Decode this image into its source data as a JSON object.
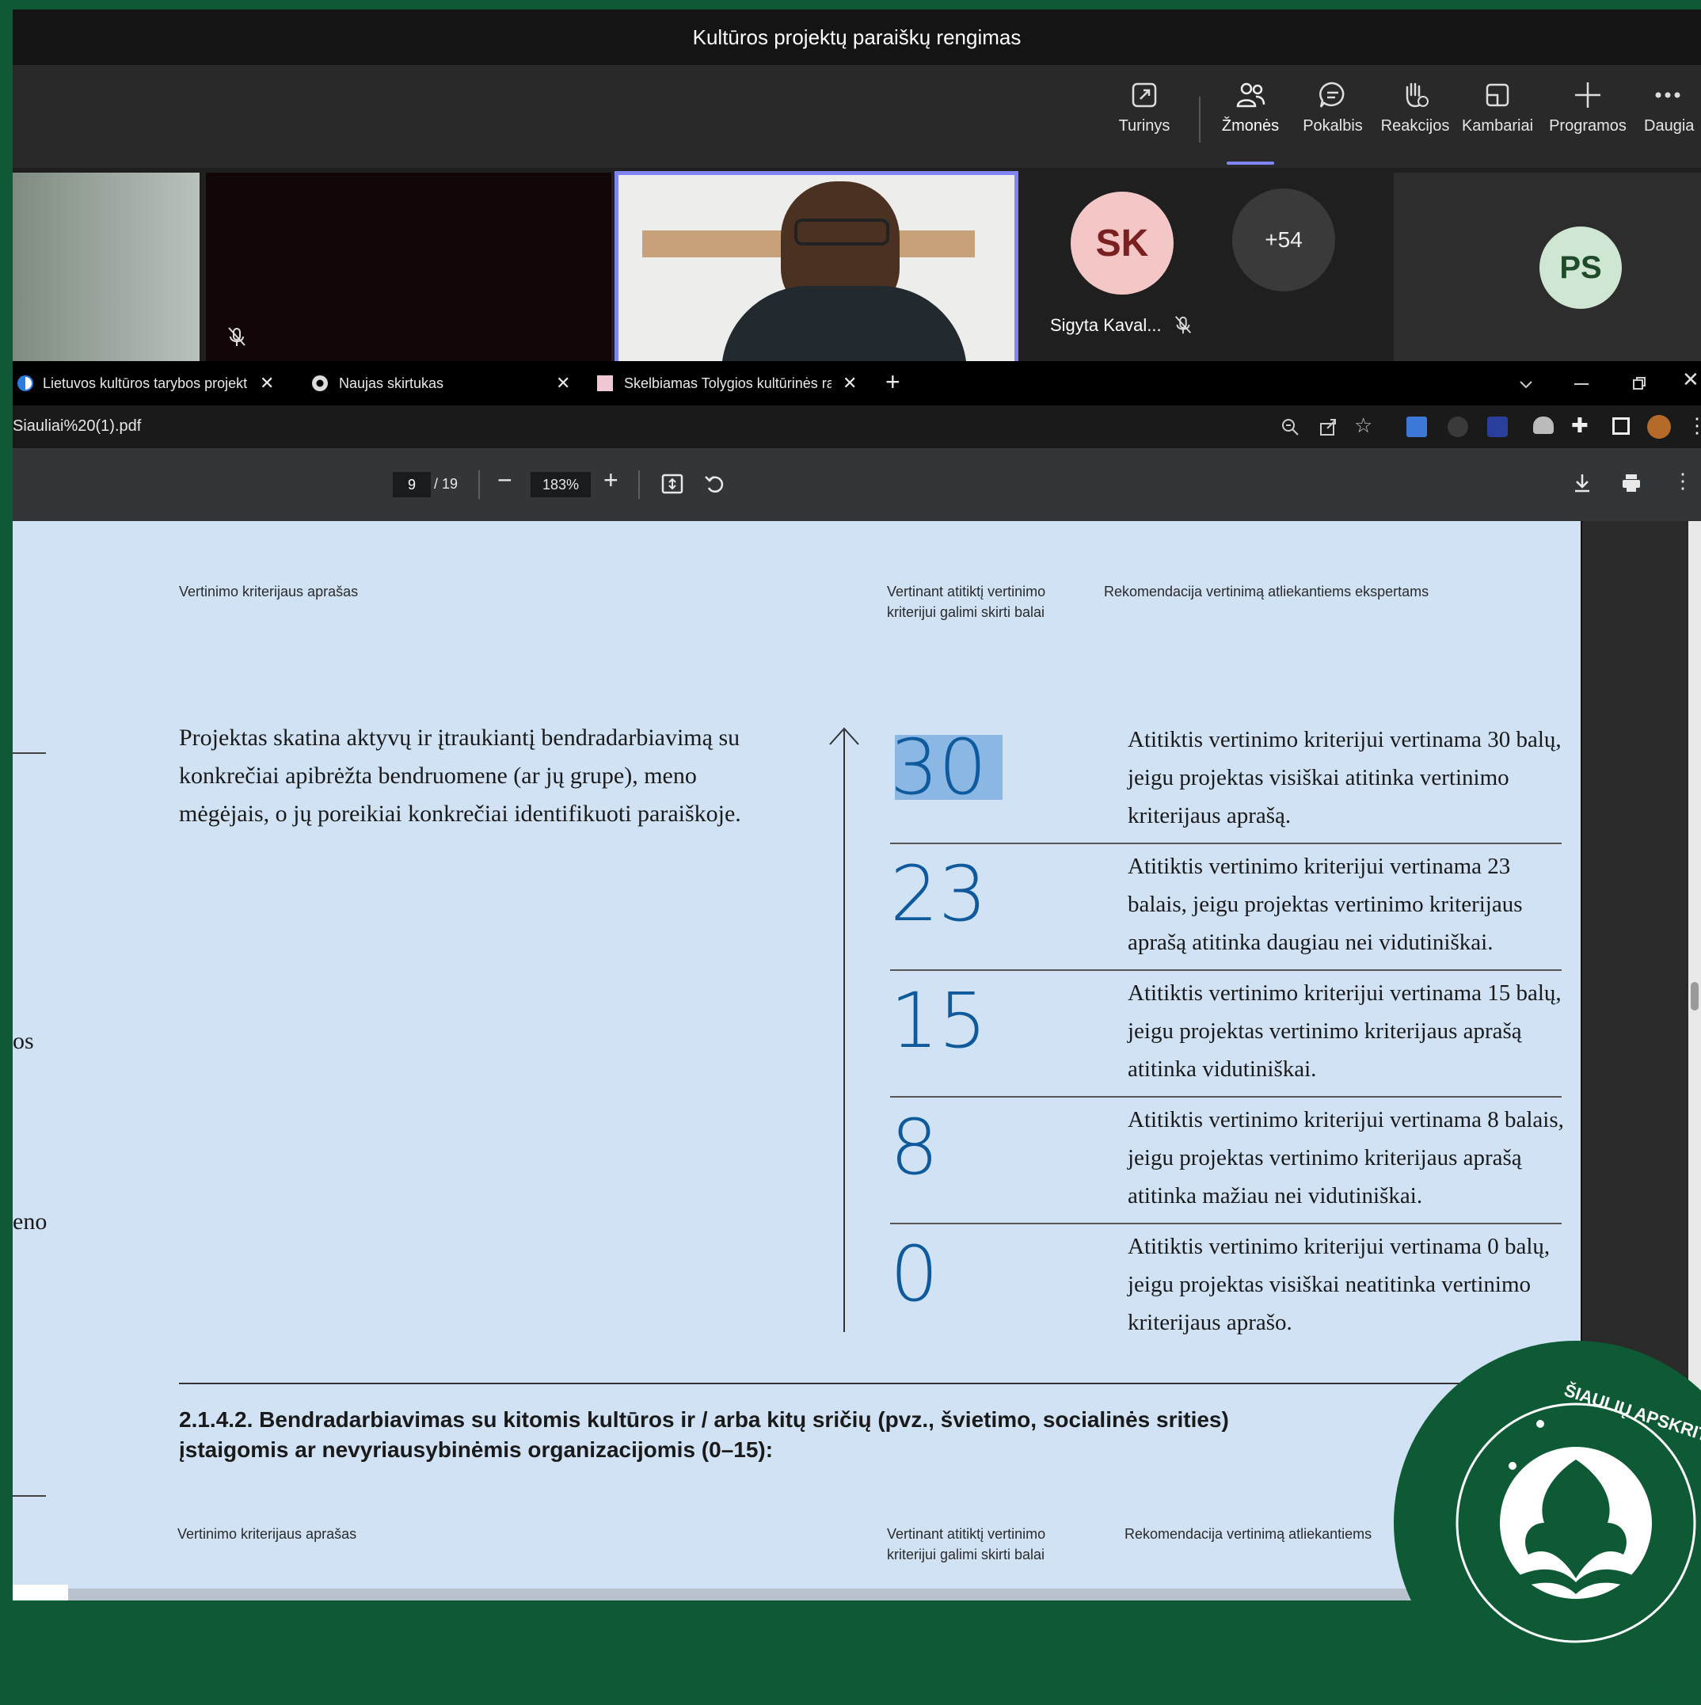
{
  "meeting": {
    "title": "Kultūros projektų paraiškų rengimas",
    "toolbar": [
      {
        "label": "Turinys",
        "icon": "share-content-icon"
      },
      {
        "label": "Žmonės",
        "icon": "people-icon"
      },
      {
        "label": "Pokalbis",
        "icon": "chat-icon"
      },
      {
        "label": "Reakcijos",
        "icon": "raise-hand-icon"
      },
      {
        "label": "Kambariai",
        "icon": "rooms-icon"
      },
      {
        "label": "Programos",
        "icon": "plus-icon"
      },
      {
        "label": "Daugia",
        "icon": "more-icon"
      }
    ],
    "participants": {
      "sk_initials": "SK",
      "sk_name": "Sigyta Kaval...",
      "more_count": "+54",
      "ps_initials": "PS"
    }
  },
  "browser": {
    "tabs": [
      {
        "label": "Lietuvos kultūros tarybos projekt"
      },
      {
        "label": "Naujas skirtukas"
      },
      {
        "label": "Skelbiamas Tolygios kultūrinės ra"
      }
    ],
    "new_tab": "+",
    "address": "Siauliai%20(1).pdf"
  },
  "pdf": {
    "page_current": "9",
    "page_total": "/ 19",
    "zoom": "183%",
    "header": {
      "col1": "Vertinimo kriterijaus aprašas",
      "col2": "Vertinant atitiktį vertinimo kriterijui galimi skirti balai",
      "col3": "Rekomendacija vertinimą atliekantiems ekspertams"
    },
    "criterion": "Projektas skatina aktyvų ir įtraukiantį bendradarbiavimą su konkrečiai apibrėžta bendruomene (ar jų grupe), meno mėgėjais, o jų poreikiai konkrečiai identifikuoti paraiškoje.",
    "scores": [
      {
        "value": "30",
        "text": "Atitiktis vertinimo kriterijui vertinama 30 balų, jeigu projektas visiškai atitinka vertinimo kriterijaus aprašą."
      },
      {
        "value": "23",
        "text": "Atitiktis vertinimo kriterijui vertinama 23 balais, jeigu projektas vertinimo kriterijaus aprašą atitinka daugiau nei vidutiniškai."
      },
      {
        "value": "15",
        "text": "Atitiktis vertinimo kriterijui vertinama 15 balų, jeigu projektas vertinimo kriterijaus aprašą atitinka vidutiniškai."
      },
      {
        "value": "8",
        "text": "Atitiktis vertinimo kriterijui vertinama 8 balais, jeigu projektas vertinimo kriterijaus aprašą atitinka mažiau nei vidutiniškai."
      },
      {
        "value": "0",
        "text": "Atitiktis vertinimo kriterijui vertinama 0 balų, jeigu projektas visiškai neatitinka vertinimo kriterijaus aprašo."
      }
    ],
    "section_title": "2.1.4.2. Bendradarbiavimas su kitomis kultūros ir / arba kitų sričių (pvz., švietimo, socialinės srities) įstaigomis ar nevyriausybinėmis organizacijomis (0–15):",
    "header2": {
      "col1": "Vertinimo kriterijaus aprašas",
      "col2": "Vertinant atitiktį vertinimo kriterijui galimi skirti balai",
      "col3": "Rekomendacija vertinimą atliekantiems"
    },
    "left_fragments": [
      "os",
      "eno"
    ]
  },
  "logo": {
    "text": "ŠIAULIŲ APSKRITIES POVILO VIŠINSKIO VIEŠOJI BIBLIOTEKA"
  },
  "colors": {
    "brand_green": "#0d5a34",
    "teams_accent": "#7f85f5",
    "score_blue": "#0f5a9c",
    "page_bg": "#d0e2f4"
  }
}
